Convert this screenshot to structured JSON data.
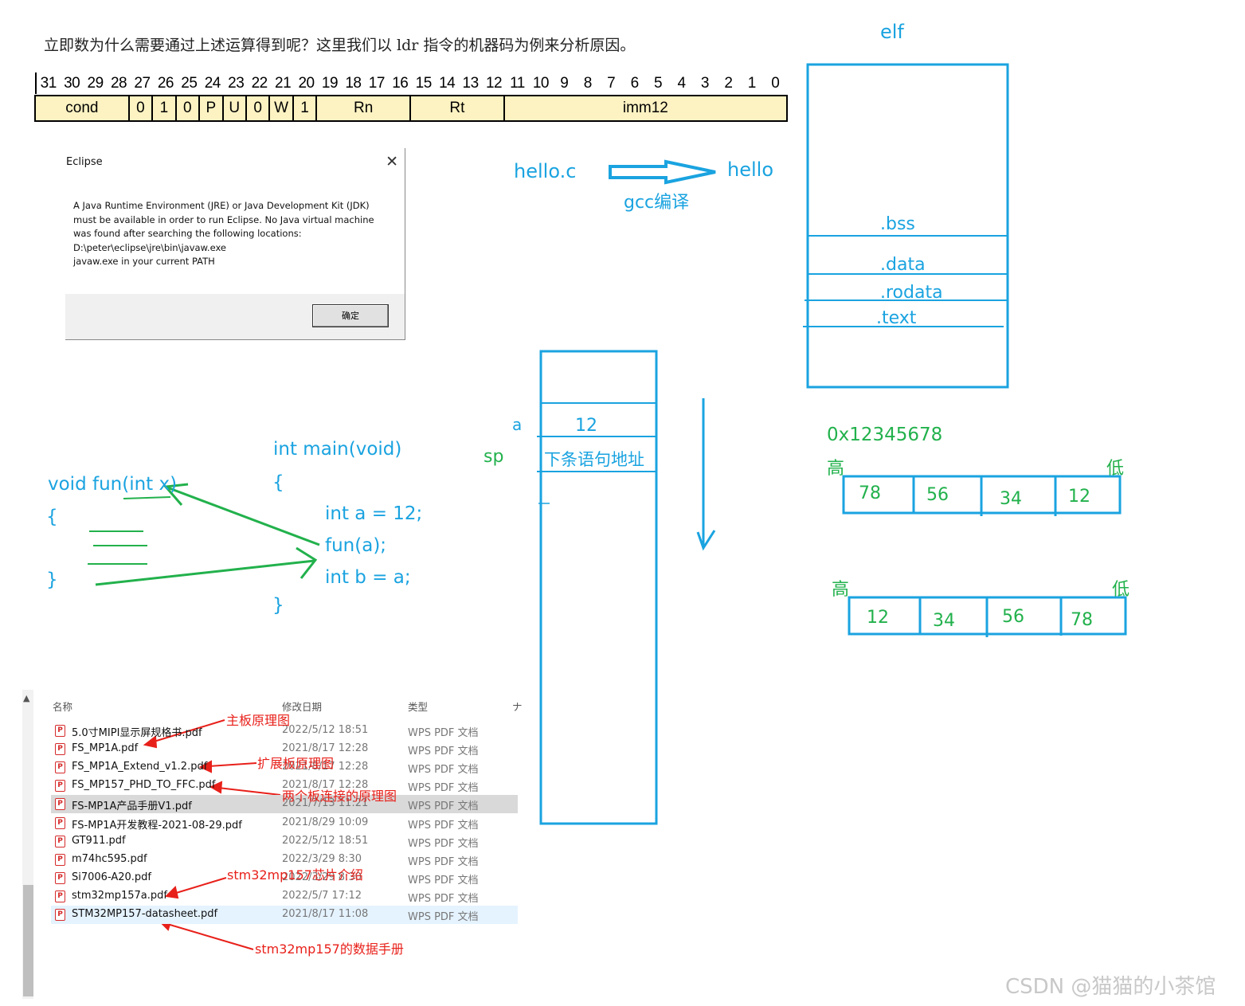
{
  "intro_text": "立即数为什么需要通过上述运算得到呢？这里我们以 ldr 指令的机器码为例来分析原因。",
  "ldr_encoding": {
    "bits": [
      "31",
      "30",
      "29",
      "28",
      "27",
      "26",
      "25",
      "24",
      "23",
      "22",
      "21",
      "20",
      "19",
      "18",
      "17",
      "16",
      "15",
      "14",
      "13",
      "12",
      "11",
      "10",
      "9",
      "8",
      "7",
      "6",
      "5",
      "4",
      "3",
      "2",
      "1",
      "0"
    ],
    "fields": [
      {
        "label": "cond",
        "bits": 4
      },
      {
        "label": "0",
        "bits": 1
      },
      {
        "label": "1",
        "bits": 1
      },
      {
        "label": "0",
        "bits": 1
      },
      {
        "label": "P",
        "bits": 1
      },
      {
        "label": "U",
        "bits": 1
      },
      {
        "label": "0",
        "bits": 1
      },
      {
        "label": "W",
        "bits": 1
      },
      {
        "label": "1",
        "bits": 1
      },
      {
        "label": "Rn",
        "bits": 4
      },
      {
        "label": "Rt",
        "bits": 4
      },
      {
        "label": "imm12",
        "bits": 12
      }
    ]
  },
  "eclipse_dialog": {
    "title": "Eclipse",
    "message": "A Java Runtime Environment (JRE) or Java Development Kit (JDK)\nmust be available in order to run Eclipse. No Java virtual machine\nwas found after searching the following locations:\nD:\\peter\\eclipse\\jre\\bin\\javaw.exe\njavaw.exe in your current PATH",
    "ok_label": "确定",
    "close_glyph": "✕"
  },
  "compile": {
    "source": "hello.c",
    "output": "hello",
    "tool": "gcc编译"
  },
  "elf": {
    "title": "elf",
    "sections": [
      ".bss",
      ".data",
      ".rodata",
      ".text"
    ]
  },
  "stack": {
    "var_label": "a",
    "var_value": "12",
    "sp_label": "sp",
    "return_slot": "下条语句地址"
  },
  "code": {
    "fun_sig": "void fun(int x)",
    "fun_open": "{",
    "fun_close": "}",
    "main_sig": "int main(void)",
    "main_open": "{",
    "main_lines": [
      "int a = 12;",
      "fun(a);",
      "int b = a;"
    ],
    "main_close": "}"
  },
  "endianness": {
    "value": "0x12345678",
    "high_label": "高",
    "low_label": "低",
    "row1": [
      "78",
      "56",
      "34",
      "12"
    ],
    "row2": [
      "12",
      "34",
      "56",
      "78"
    ]
  },
  "explorer": {
    "headers": {
      "name": "名称",
      "date": "修改日期",
      "type": "类型",
      "extra": "ナ"
    },
    "files": [
      {
        "name": "5.0寸MIPI显示屏规格书.pdf",
        "date": "2022/5/12 18:51",
        "type": "WPS PDF 文档"
      },
      {
        "name": "FS_MP1A.pdf",
        "date": "2021/8/17 12:28",
        "type": "WPS PDF 文档"
      },
      {
        "name": "FS_MP1A_Extend_v1.2.pdf",
        "date": "2021/8/17 12:28",
        "type": "WPS PDF 文档"
      },
      {
        "name": "FS_MP157_PHD_TO_FFC.pdf",
        "date": "2021/8/17 12:28",
        "type": "WPS PDF 文档"
      },
      {
        "name": "FS-MP1A产品手册V1.pdf",
        "date": "2021/7/13 11:21",
        "type": "WPS PDF 文档"
      },
      {
        "name": "FS-MP1A开发教程-2021-08-29.pdf",
        "date": "2021/8/29 10:09",
        "type": "WPS PDF 文档"
      },
      {
        "name": "GT911.pdf",
        "date": "2022/5/12 18:51",
        "type": "WPS PDF 文档"
      },
      {
        "name": "m74hc595.pdf",
        "date": "2022/3/29 8:30",
        "type": "WPS PDF 文档"
      },
      {
        "name": "Si7006-A20.pdf",
        "date": "2022/3/29 8:30",
        "type": "WPS PDF 文档"
      },
      {
        "name": "stm32mp157a.pdf",
        "date": "2022/5/7 17:12",
        "type": "WPS PDF 文档"
      },
      {
        "name": "STM32MP157-datasheet.pdf",
        "date": "2021/8/17 11:08",
        "type": "WPS PDF 文档"
      }
    ],
    "annotations": [
      "主板原理图",
      "扩展板原理图",
      "两个板连接的原理图",
      "stm32mp157芯片介绍",
      "stm32mp157的数据手册"
    ]
  },
  "watermark": "CSDN @猫猫的小茶馆",
  "colors": {
    "blue": "#1aa3e0",
    "green": "#22b14c",
    "red": "#e8201a",
    "table_fill": "#fcf2c2"
  }
}
